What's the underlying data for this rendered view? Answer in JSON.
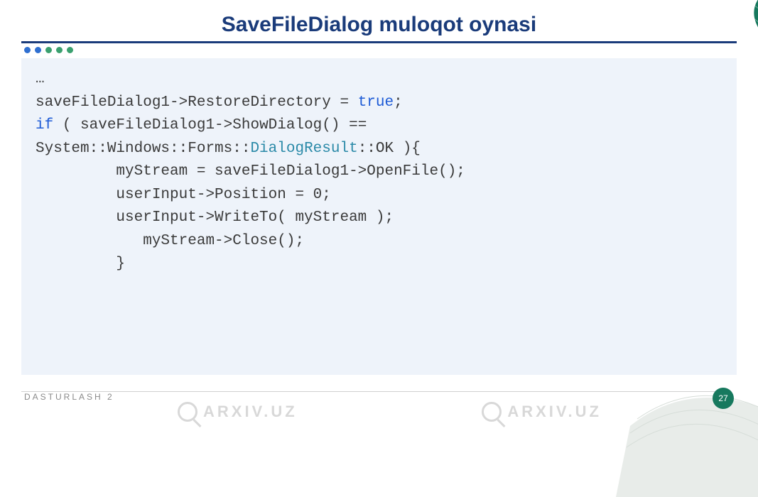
{
  "title": "SaveFileDialog muloqot oynasi",
  "dots_colors": [
    "#2f6fd0",
    "#2f6fd0",
    "#3aa06f",
    "#3aa06f",
    "#3aa06f"
  ],
  "code": {
    "l0": "…",
    "l1a": "saveFileDialog1->RestoreDirectory = ",
    "l1b": "true",
    "l1c": ";",
    "l2a": "if",
    "l2b": " ( saveFileDialog1->ShowDialog() ==",
    "l3a": "System::Windows::Forms::",
    "l3b": "DialogResult",
    "l3c": "::OK ){",
    "l4": "         myStream = saveFileDialog1->OpenFile();",
    "l5": "         userInput->Position = 0;",
    "l6": "         userInput->WriteTo( myStream );",
    "l7": "            myStream->Close();",
    "l8": "",
    "l9": "         }"
  },
  "footer": "DASTURLASH 2",
  "page": "27",
  "watermark_text": "ARXIV.UZ"
}
